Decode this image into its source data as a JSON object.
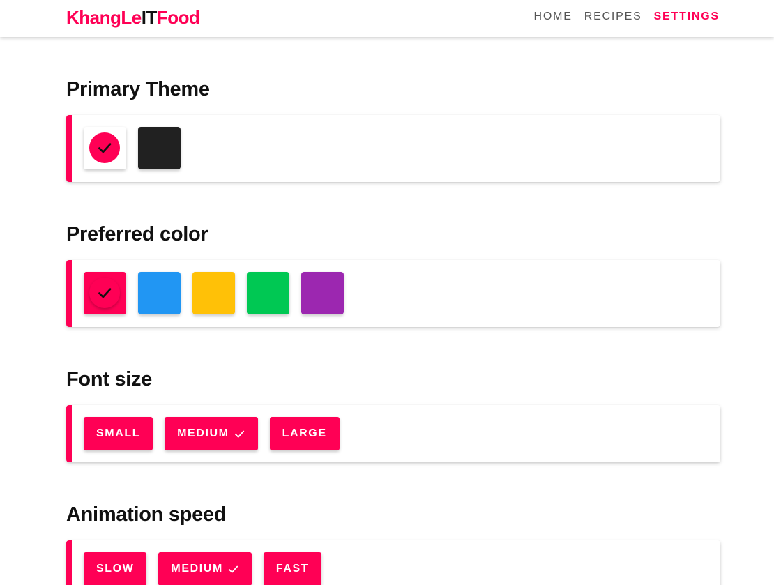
{
  "brand": {
    "part1": "KhangLe",
    "part2": "IT",
    "part3": "Food"
  },
  "nav": {
    "home": "HOME",
    "recipes": "RECIPES",
    "settings": "SETTINGS"
  },
  "colors": {
    "accent": "#ff0055",
    "dark": "#212121",
    "blue": "#2196f3",
    "amber": "#ffc107",
    "green": "#00c853",
    "purple": "#9c27b0"
  },
  "theme": {
    "title": "Primary Theme",
    "options": [
      {
        "name": "light",
        "color": "#ffffff",
        "selected": true
      },
      {
        "name": "dark",
        "color": "#212121",
        "selected": false
      }
    ]
  },
  "preferred_color": {
    "title": "Preferred color",
    "options": [
      {
        "name": "pink",
        "color": "#ff0055",
        "selected": true
      },
      {
        "name": "blue",
        "color": "#2196f3",
        "selected": false
      },
      {
        "name": "amber",
        "color": "#ffc107",
        "selected": false
      },
      {
        "name": "green",
        "color": "#00c853",
        "selected": false
      },
      {
        "name": "purple",
        "color": "#9c27b0",
        "selected": false
      }
    ]
  },
  "font_size": {
    "title": "Font size",
    "options": [
      {
        "label": "SMALL",
        "selected": false
      },
      {
        "label": "MEDIUM",
        "selected": true
      },
      {
        "label": "LARGE",
        "selected": false
      }
    ]
  },
  "animation_speed": {
    "title": "Animation speed",
    "options": [
      {
        "label": "SLOW",
        "selected": false
      },
      {
        "label": "MEDIUM",
        "selected": true
      },
      {
        "label": "FAST",
        "selected": false
      }
    ]
  },
  "icons": {
    "selected_marker": "check-icon"
  }
}
